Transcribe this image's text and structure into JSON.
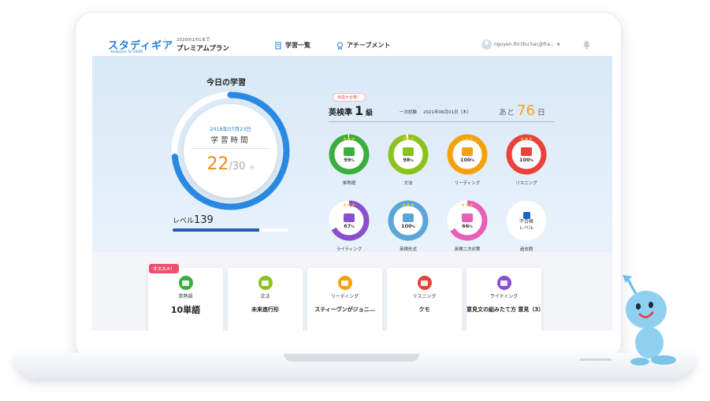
{
  "header": {
    "logo_text": "スタディギア",
    "logo_sub": "StudyGear for EIKEN",
    "plan_until": "2020/01/01まで",
    "plan_name": "プレミアムプラン",
    "nav": [
      {
        "label": "学習一覧",
        "icon": "document-list-icon"
      },
      {
        "label": "アチーブメント",
        "icon": "medal-icon"
      }
    ],
    "user_email": "nguyen.thi.thu.hac@fra...",
    "colors": {
      "brand": "#1f7ed6"
    }
  },
  "today": {
    "title": "今日の学習",
    "date": "2018年07月23日",
    "label": "学習時間",
    "minutes_done": "22",
    "minutes_goal": "/30",
    "unit": "分",
    "progress_fraction": 0.733,
    "level_label": "レベル",
    "level": "139",
    "level_progress_fraction": 0.75
  },
  "exam": {
    "goal_badge": "目指せ合格！",
    "name": "英検準",
    "grade_num": "1",
    "grade_unit": "級",
    "first_exam_label": "一次試験",
    "first_exam_date": "2021年06月01日（木）",
    "countdown_prefix": "あと",
    "days_left": "76",
    "countdown_suffix": "日"
  },
  "skills": [
    {
      "name": "単熟語",
      "percent": "99",
      "value": 0.99,
      "color": "#3aae3f",
      "icon": "vocabulary-card-icon"
    },
    {
      "name": "文法",
      "percent": "98",
      "value": 0.98,
      "color": "#8cc21f",
      "icon": "grammar-cards-icon"
    },
    {
      "name": "リーディング",
      "percent": "100",
      "value": 1.0,
      "color": "#f2a20c",
      "icon": "book-icon"
    },
    {
      "name": "リスニング",
      "percent": "100",
      "value": 1.0,
      "color": "#e8433b",
      "icon": "ear-icon"
    },
    {
      "name": "ライティング",
      "percent": "67",
      "value": 0.67,
      "color": "#8a4fcf",
      "icon": "writing-document-icon"
    },
    {
      "name": "英検形式",
      "percent": "100",
      "value": 1.0,
      "color": "#5aa6d8",
      "icon": "pencil-icon"
    },
    {
      "name": "英検二次対策",
      "percent": "66",
      "value": 0.66,
      "color": "#e95fb8",
      "icon": "speech-bubble-icon"
    },
    {
      "name": "過去問",
      "percent": "",
      "value": 0,
      "color": "#1f63c6",
      "icon": "past-exam-icon",
      "fail_text_1": "不合格",
      "fail_text_2": "レベル"
    }
  ],
  "percent_sign": "%",
  "recommended": {
    "badge": "オススメ！",
    "cards": [
      {
        "category": "単熟語",
        "title": "10単語",
        "color": "#3aae3f",
        "icon": "vocabulary-card-icon"
      },
      {
        "category": "文法",
        "title": "未来進行形",
        "color": "#8cc21f",
        "icon": "grammar-cards-icon"
      },
      {
        "category": "リーディング",
        "title": "スティーヴンがジョニ…",
        "color": "#f2a20c",
        "icon": "book-icon"
      },
      {
        "category": "リスニング",
        "title": "クモ",
        "color": "#e8433b",
        "icon": "ear-icon"
      },
      {
        "category": "ライティング",
        "title": "意見文の組みたて方 意見（3）",
        "color": "#8a4fcf",
        "icon": "writing-document-icon"
      }
    ]
  }
}
